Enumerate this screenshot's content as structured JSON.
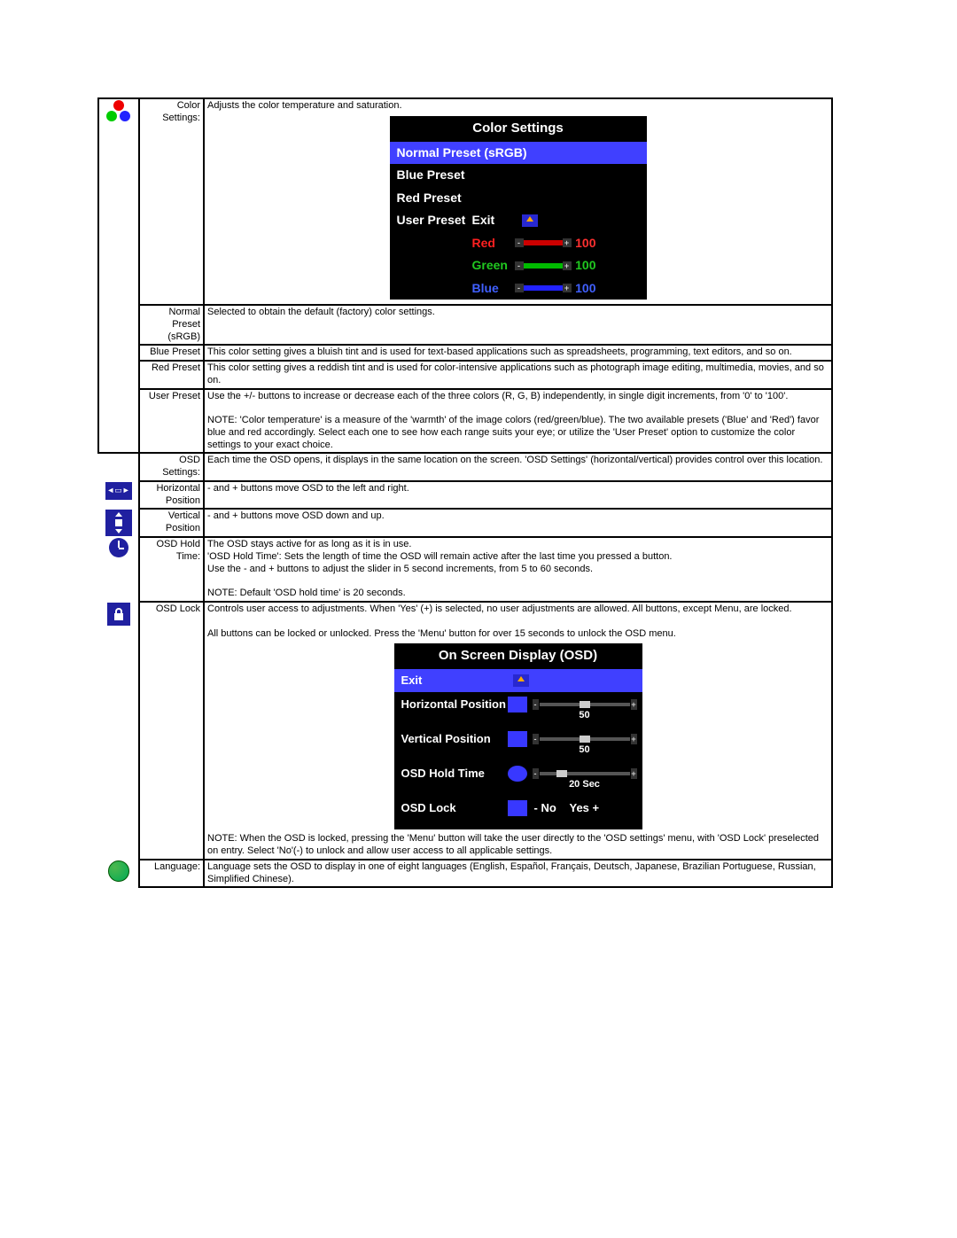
{
  "color": {
    "label": "Color Settings:",
    "desc": "Adjusts the color temperature and saturation.",
    "osd": {
      "title": "Color Settings",
      "normal": "Normal Preset (sRGB)",
      "blue": "Blue Preset",
      "red": "Red Preset",
      "user": "User Preset",
      "exit": "Exit",
      "r": "Red",
      "g": "Green",
      "b": "Blue",
      "rv": "100",
      "gv": "100",
      "bv": "100"
    },
    "rows": [
      {
        "name": "Normal Preset (sRGB)",
        "desc": "Selected to obtain the default (factory) color settings."
      },
      {
        "name": "Blue Preset",
        "desc": "This color setting gives a bluish tint and is used for text-based applications such as spreadsheets, programming, text editors, and so on."
      },
      {
        "name": "Red Preset",
        "desc": "This color setting gives a reddish tint and is used for color-intensive applications such as photograph image editing, multimedia, movies, and so on."
      },
      {
        "name": "User Preset",
        "desc": "Use the +/- buttons to increase or decrease each of the three colors (R, G, B) independently, in single digit increments, from '0' to '100'.\n\nNOTE: 'Color temperature' is a measure of the 'warmth' of the image colors (red/green/blue). The two available presets ('Blue' and 'Red') favor blue and red accordingly. Select each one to see how each range suits your eye; or utilize the 'User Preset' option to customize the color settings to your exact choice."
      }
    ]
  },
  "osd": {
    "label": "OSD Settings:",
    "desc": "Each time the OSD opens, it displays in the same location on the screen. 'OSD Settings' (horizontal/vertical) provides control over this location.",
    "rows": [
      {
        "name": "Horizontal Position",
        "desc": "- and + buttons move OSD to the left and right."
      },
      {
        "name": "Vertical Position",
        "desc": "- and + buttons move OSD down and up."
      },
      {
        "name": "OSD Hold Time:",
        "desc": "The OSD stays active for as long as it is in use.\n'OSD Hold Time': Sets the length of time the OSD will remain active after the last time you pressed a button.\nUse the - and + buttons to adjust the slider in 5 second increments, from 5 to 60 seconds.\n\nNOTE: Default 'OSD hold time' is 20 seconds."
      },
      {
        "name": "OSD Lock",
        "desc": "Controls user access to adjustments. When 'Yes' (+) is selected, no user adjustments are allowed. All buttons, except Menu, are locked.\n\nAll buttons can be locked or unlocked. Press the 'Menu' button for over 15 seconds to unlock the OSD menu."
      }
    ],
    "panel": {
      "title": "On Screen Display (OSD)",
      "exit": "Exit",
      "hp": "Horizontal Position",
      "hpv": "50",
      "vp": "Vertical  Position",
      "vpv": "50",
      "ht": "OSD Hold Time",
      "htv": "20 Sec",
      "lk": "OSD Lock",
      "no": "- No",
      "yes": "Yes +"
    },
    "footnote": "NOTE: When the OSD is locked, pressing the 'Menu' button will take the user directly to the 'OSD settings' menu, with 'OSD Lock' preselected on entry. Select 'No'(-) to unlock and allow user access to all applicable settings."
  },
  "lang": {
    "label": "Language:",
    "desc": "Language sets the OSD to display in one of eight languages (English, Español, Français, Deutsch, Japanese, Brazilian Portuguese, Russian, Simplified Chinese)."
  }
}
